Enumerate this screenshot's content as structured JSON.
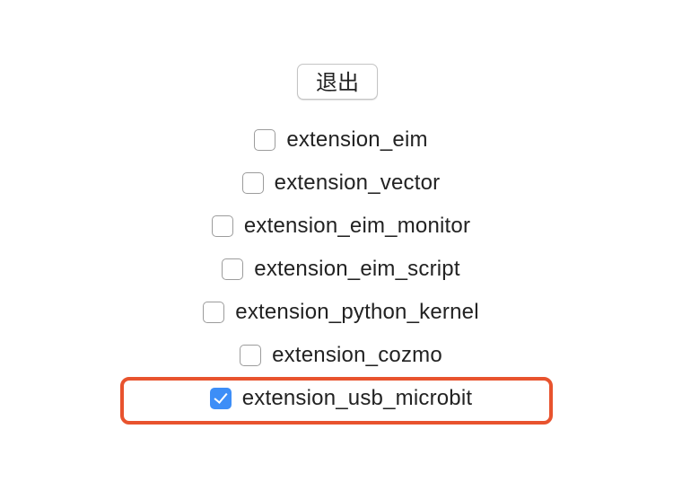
{
  "toolbar": {
    "quit_label": "退出"
  },
  "extensions": [
    {
      "label": "extension_eim",
      "checked": false
    },
    {
      "label": "extension_vector",
      "checked": false
    },
    {
      "label": "extension_eim_monitor",
      "checked": false
    },
    {
      "label": "extension_eim_script",
      "checked": false
    },
    {
      "label": "extension_python_kernel",
      "checked": false
    },
    {
      "label": "extension_cozmo",
      "checked": false
    },
    {
      "label": "extension_usb_microbit",
      "checked": true
    }
  ],
  "colors": {
    "checkbox_checked": "#3d8ef7",
    "highlight": "#e8532e"
  }
}
